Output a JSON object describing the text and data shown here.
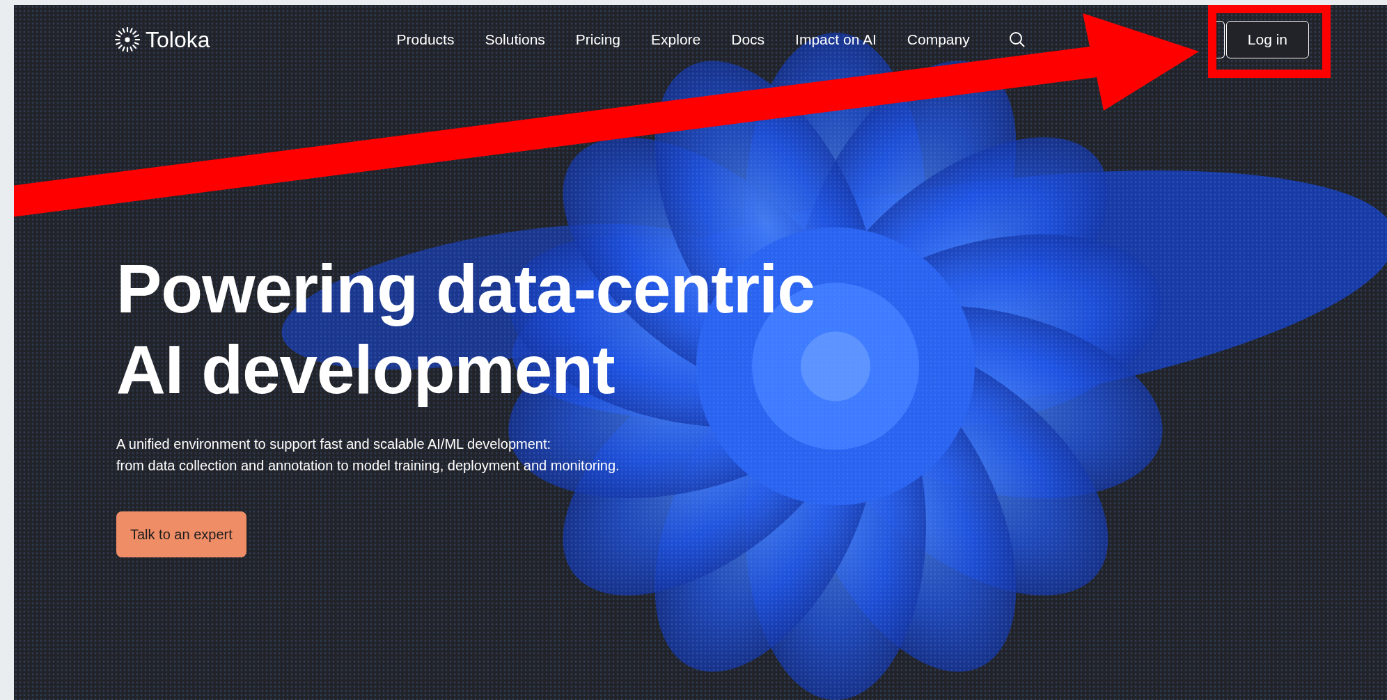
{
  "header": {
    "logo": "Toloka",
    "nav": [
      {
        "label": "Products"
      },
      {
        "label": "Solutions"
      },
      {
        "label": "Pricing"
      },
      {
        "label": "Explore"
      },
      {
        "label": "Docs"
      },
      {
        "label": "Impact on AI"
      },
      {
        "label": "Company"
      }
    ],
    "login": "Log in"
  },
  "hero": {
    "title_lines": [
      "Powering data-centric",
      "AI development"
    ],
    "subtitle_lines": [
      "A unified environment to support fast and scalable AI/ML development:",
      "from data collection and annotation to model training, deployment and monitoring."
    ],
    "cta": "Talk to an expert"
  }
}
